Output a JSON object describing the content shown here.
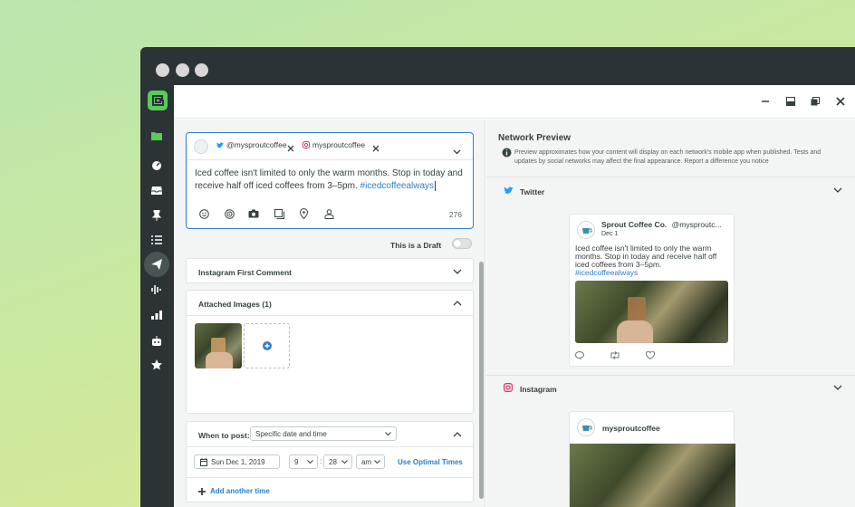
{
  "composer": {
    "profiles": [
      {
        "network": "twitter",
        "handle": "@mysproutcoffee",
        "icon": "twitter-icon"
      },
      {
        "network": "instagram",
        "handle": "mysproutcoffee",
        "icon": "instagram-icon"
      }
    ],
    "text_main": "Iced coffee isn't limited to only the warm months. Stop in today and receive half off iced coffees from 3–5pm. ",
    "hashtag": "#icedcoffeealways",
    "char_count": "276",
    "draft_label": "This is a Draft",
    "draft_enabled": false
  },
  "panels": {
    "instagram_first_comment": "Instagram First Comment",
    "attached_images": "Attached Images (1)",
    "when_to_post": "When to post:",
    "schedule_mode": "Specific date and time",
    "date": "Sun Dec 1, 2019",
    "hour": "9",
    "minute": "28",
    "ampm": "am",
    "time_separator": ":",
    "optimal_times": "Use Optimal Times",
    "add_time": "Add another time"
  },
  "preview": {
    "title": "Network Preview",
    "note": "Preview approximates how your content will display on each network's mobile app when published. Tests and updates by social networks may affect the final appearance. Report a difference you notice",
    "twitter": {
      "label": "Twitter",
      "name": "Sprout Coffee Co.",
      "handle": "@mysproutc...",
      "date": "Dec 1",
      "text": "Iced coffee isn't limited to only the warm months. Stop in today and receive half off iced coffees from 3–5pm.",
      "hashtag": "#icedcoffeealways"
    },
    "instagram": {
      "label": "Instagram",
      "username": "mysproutcoffee"
    }
  },
  "colors": {
    "accent": "#2f7ec7",
    "brand_green": "#59cb59",
    "rail": "#2b3336"
  }
}
